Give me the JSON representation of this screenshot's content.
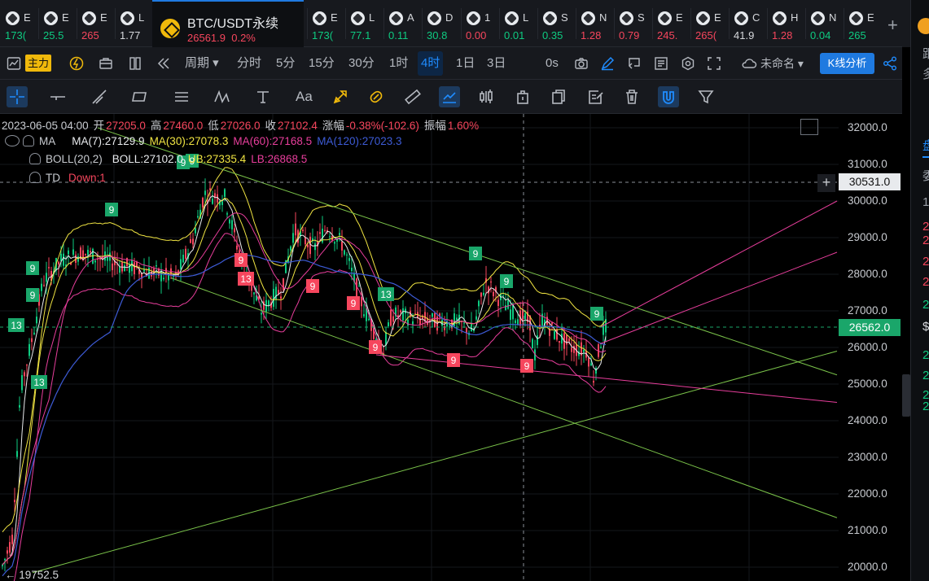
{
  "tickers": [
    {
      "sym": "E",
      "price": "173(",
      "color": "#0ecb81"
    },
    {
      "sym": "E",
      "price": "25.5",
      "color": "#0ecb81"
    },
    {
      "sym": "E",
      "price": "265",
      "color": "#f6465d"
    },
    {
      "sym": "L",
      "price": "1.77",
      "color": "#d6d8dc"
    },
    {
      "sym": "E",
      "price": "173(",
      "color": "#0ecb81"
    },
    {
      "sym": "L",
      "price": "77.1",
      "color": "#0ecb81"
    },
    {
      "sym": "A",
      "price": "0.11",
      "color": "#0ecb81"
    },
    {
      "sym": "D",
      "price": "30.8",
      "color": "#0ecb81"
    },
    {
      "sym": "1",
      "price": "0.00",
      "color": "#f6465d"
    },
    {
      "sym": "L",
      "price": "0.01",
      "color": "#0ecb81"
    },
    {
      "sym": "S",
      "price": "0.35",
      "color": "#0ecb81"
    },
    {
      "sym": "N",
      "price": "1.28",
      "color": "#f6465d"
    },
    {
      "sym": "S",
      "price": "0.79",
      "color": "#f6465d"
    },
    {
      "sym": "E",
      "price": "245.",
      "color": "#f6465d"
    },
    {
      "sym": "E",
      "price": "265(",
      "color": "#f6465d"
    },
    {
      "sym": "C",
      "price": "41.9",
      "color": "#d6d8dc"
    },
    {
      "sym": "H",
      "price": "1.28",
      "color": "#f6465d"
    },
    {
      "sym": "N",
      "price": "0.04",
      "color": "#0ecb81"
    },
    {
      "sym": "E",
      "price": "265",
      "color": "#0ecb81"
    }
  ],
  "active_tab": {
    "name": "BTC/USDT永续",
    "price": "26561.9",
    "change": "0.2%"
  },
  "toolbar": {
    "main_label": "主力",
    "period_label": "周期",
    "timeframes": [
      "分时",
      "5分",
      "15分",
      "30分",
      "1时",
      "4时",
      "1日",
      "3日"
    ],
    "active_timeframe": "4时",
    "zero_s": "0s",
    "layout_name": "未命名",
    "kline_analysis": "K线分析"
  },
  "ohlc": {
    "date": "2023-06-05 04:00",
    "open_label": "开",
    "open": "27205.0",
    "high_label": "高",
    "high": "27460.0",
    "low_label": "低",
    "low": "27026.0",
    "close_label": "收",
    "close": "27102.4",
    "change_label": "涨幅",
    "change": "-0.38%(-102.6)",
    "amp_label": "振幅",
    "amp": "1.60%"
  },
  "indicators": {
    "ma_name": "MA",
    "ma7": "MA(7):27129.9",
    "ma30": "MA(30):27078.3",
    "ma60": "MA(60):27168.5",
    "ma120": "MA(120):27023.3",
    "boll_name": "BOLL(20,2)",
    "boll": "BOLL:27102.0",
    "ub": "UB:27335.4",
    "lb": "LB:26868.5",
    "td_name": "TD",
    "td": "Down:1"
  },
  "colors": {
    "ma7": "#e8eaed",
    "ma30": "#f0e442",
    "ma60": "#e83e9c",
    "ma120": "#3d5bd6",
    "up": "#0ecb81",
    "down": "#f6465d"
  },
  "y_axis": [
    "32000.0",
    "31000.0",
    "30000.0",
    "29000.0",
    "28000.0",
    "27000.0",
    "26000.0",
    "25000.0",
    "24000.0",
    "23000.0",
    "22000.0",
    "21000.0",
    "20000.0"
  ],
  "crosshair_price": "30531.0",
  "last_price": "26562.0",
  "low_marker": "← 19752.5",
  "td_markers": [
    {
      "label": "9",
      "kind": "up"
    },
    {
      "label": "9",
      "kind": "up"
    },
    {
      "label": "13",
      "kind": "up"
    },
    {
      "label": "9",
      "kind": "up"
    },
    {
      "label": "13",
      "kind": "up"
    },
    {
      "label": "9",
      "kind": "up"
    },
    {
      "label": "9",
      "kind": "up"
    },
    {
      "label": "9",
      "kind": "up"
    },
    {
      "label": "9",
      "kind": "up"
    },
    {
      "label": "13",
      "kind": "up"
    },
    {
      "label": "9",
      "kind": "up"
    },
    {
      "label": "9",
      "kind": "down"
    },
    {
      "label": "13",
      "kind": "down"
    },
    {
      "label": "9",
      "kind": "down"
    },
    {
      "label": "9",
      "kind": "down"
    },
    {
      "label": "9",
      "kind": "down"
    },
    {
      "label": "9",
      "kind": "down"
    },
    {
      "label": "9",
      "kind": "down"
    }
  ],
  "right_panel": [
    "跟",
    "多",
    "盘",
    "委",
    "1",
    "2",
    "2",
    "2",
    "2",
    "2",
    "$",
    "2",
    "2",
    "2",
    "2"
  ]
}
